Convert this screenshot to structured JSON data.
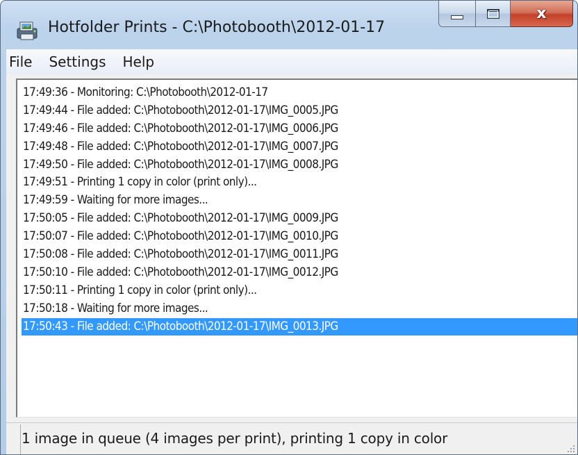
{
  "window": {
    "title": "Hotfolder Prints - C:\\Photobooth\\2012-01-17"
  },
  "menu": {
    "items": [
      {
        "label": "File"
      },
      {
        "label": "Settings"
      },
      {
        "label": "Help"
      }
    ]
  },
  "caption_buttons": {
    "close_glyph": "x"
  },
  "log": {
    "lines": [
      {
        "text": "17:49:36 - Monitoring: C:\\Photobooth\\2012-01-17",
        "selected": false
      },
      {
        "text": "17:49:44 - File added: C:\\Photobooth\\2012-01-17\\IMG_0005.JPG",
        "selected": false
      },
      {
        "text": "17:49:46 - File added: C:\\Photobooth\\2012-01-17\\IMG_0006.JPG",
        "selected": false
      },
      {
        "text": "17:49:48 - File added: C:\\Photobooth\\2012-01-17\\IMG_0007.JPG",
        "selected": false
      },
      {
        "text": "17:49:50 - File added: C:\\Photobooth\\2012-01-17\\IMG_0008.JPG",
        "selected": false
      },
      {
        "text": "17:49:51 - Printing 1 copy in color (print only)...",
        "selected": false
      },
      {
        "text": "17:49:59 - Waiting for more images...",
        "selected": false
      },
      {
        "text": "17:50:05 - File added: C:\\Photobooth\\2012-01-17\\IMG_0009.JPG",
        "selected": false
      },
      {
        "text": "17:50:07 - File added: C:\\Photobooth\\2012-01-17\\IMG_0010.JPG",
        "selected": false
      },
      {
        "text": "17:50:08 - File added: C:\\Photobooth\\2012-01-17\\IMG_0011.JPG",
        "selected": false
      },
      {
        "text": "17:50:10 - File added: C:\\Photobooth\\2012-01-17\\IMG_0012.JPG",
        "selected": false
      },
      {
        "text": "17:50:11 - Printing 1 copy in color (print only)...",
        "selected": false
      },
      {
        "text": "17:50:18 - Waiting for more images...",
        "selected": false
      },
      {
        "text": "17:50:43 - File added: C:\\Photobooth\\2012-01-17\\IMG_0013.JPG",
        "selected": true
      }
    ]
  },
  "status": {
    "text": "1 image in queue (4 images per print), printing 1 copy in color"
  },
  "colors": {
    "selection": "#3399ff",
    "titlebar": "#b9d1ea",
    "close_button": "#c7432b"
  },
  "icons": {
    "app": "photo-printer-icon",
    "minimize": "minimize-icon",
    "maximize": "maximize-icon",
    "close": "close-icon",
    "grip": "resize-grip-icon"
  }
}
